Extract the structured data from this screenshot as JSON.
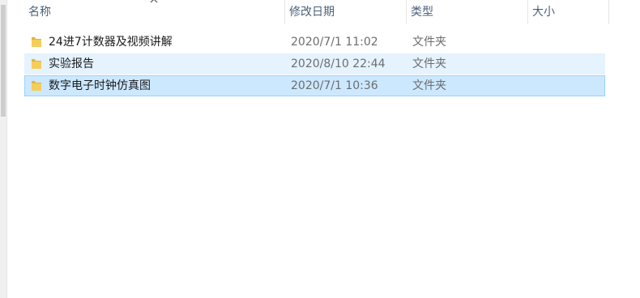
{
  "columns": {
    "name": "名称",
    "modified": "修改日期",
    "type": "类型",
    "size": "大小"
  },
  "files": [
    {
      "name": "24进7计数器及视频讲解",
      "modified": "2020/7/1 11:02",
      "type": "文件夹",
      "icon": "folder-icon",
      "state": "normal"
    },
    {
      "name": "实验报告",
      "modified": "2020/8/10 22:44",
      "type": "文件夹",
      "icon": "folder-icon",
      "state": "hover"
    },
    {
      "name": "数字电子时钟仿真图",
      "modified": "2020/7/1 10:36",
      "type": "文件夹",
      "icon": "folder-icon",
      "state": "selected"
    }
  ],
  "colors": {
    "hover": "#e5f3ff",
    "selected": "#cce8ff",
    "selected_border": "#99d1ff",
    "header_text": "#4c607a",
    "folder": "#f0c24a"
  }
}
